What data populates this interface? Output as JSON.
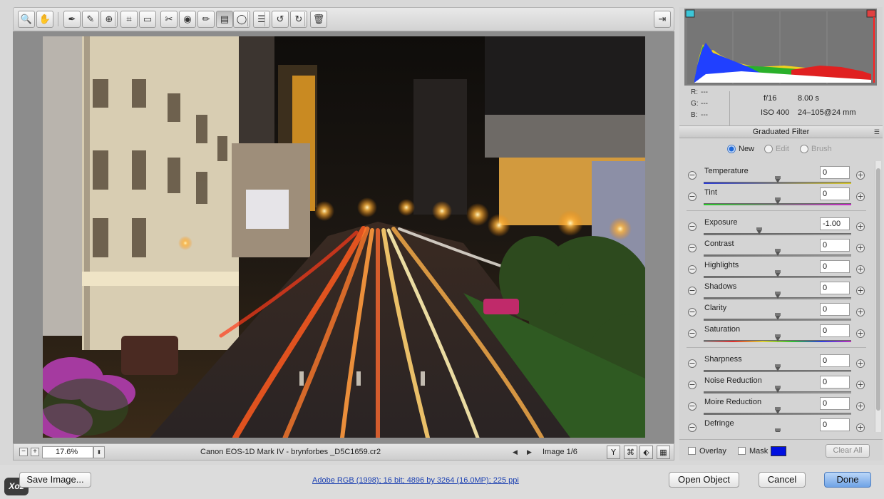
{
  "toolbar": {
    "tools": [
      {
        "name": "zoom-tool-icon",
        "glyph": "🔍"
      },
      {
        "name": "hand-tool-icon",
        "glyph": "✋"
      },
      {
        "name": "white-balance-tool-icon",
        "glyph": "✒"
      },
      {
        "name": "color-sampler-tool-icon",
        "glyph": "✎"
      },
      {
        "name": "targeted-adjustment-tool-icon",
        "glyph": "⊕"
      },
      {
        "name": "crop-tool-icon",
        "glyph": "⌗"
      },
      {
        "name": "straighten-tool-icon",
        "glyph": "▭"
      },
      {
        "name": "spot-removal-tool-icon",
        "glyph": "✂"
      },
      {
        "name": "red-eye-tool-icon",
        "glyph": "◉"
      },
      {
        "name": "adjustment-brush-icon",
        "glyph": "✏"
      },
      {
        "name": "graduated-filter-icon",
        "glyph": "▤"
      },
      {
        "name": "radial-filter-icon",
        "glyph": "◯"
      },
      {
        "name": "preferences-icon",
        "glyph": "☰"
      },
      {
        "name": "rotate-left-icon",
        "glyph": "↺"
      },
      {
        "name": "rotate-right-icon",
        "glyph": "↻"
      },
      {
        "name": "trash-icon",
        "glyph": "🗑"
      }
    ],
    "export_glyph": "⇥"
  },
  "status": {
    "zoom": "17.6%",
    "zoom_minus": "−",
    "zoom_plus": "+",
    "zoom_step": "⬍",
    "filename": "Canon EOS-1D Mark IV  -  brynforbes _D5C1659.cr2",
    "nav_prev": "◀",
    "nav_next": "▶",
    "image_count": "Image 1/6",
    "view_glyphs": [
      "Y",
      "⌘",
      "⬖",
      "▦"
    ]
  },
  "readout": {
    "r_label": "R:",
    "r_value": "---",
    "g_label": "G:",
    "g_value": "---",
    "b_label": "B:",
    "b_value": "---",
    "aperture": "f/16",
    "shutter": "8.00 s",
    "iso": "ISO 400",
    "lens": "24–105@24 mm"
  },
  "panel": {
    "title": "Graduated Filter",
    "menu_glyph": "☰",
    "modes": [
      {
        "label": "New",
        "selected": true
      },
      {
        "label": "Edit",
        "selected": false
      },
      {
        "label": "Brush",
        "selected": false
      }
    ],
    "sliders": [
      {
        "label": "Temperature",
        "value": "0",
        "level": 0.5,
        "track": "temp"
      },
      {
        "label": "Tint",
        "value": "0",
        "level": 0.5,
        "track": "tint"
      },
      {
        "label": "Exposure",
        "value": "-1.00",
        "level": 0.375,
        "track": "gray",
        "sep_before": true
      },
      {
        "label": "Contrast",
        "value": "0",
        "level": 0.5,
        "track": "gray"
      },
      {
        "label": "Highlights",
        "value": "0",
        "level": 0.5,
        "track": "gray"
      },
      {
        "label": "Shadows",
        "value": "0",
        "level": 0.5,
        "track": "gray"
      },
      {
        "label": "Clarity",
        "value": "0",
        "level": 0.5,
        "track": "gray"
      },
      {
        "label": "Saturation",
        "value": "0",
        "level": 0.5,
        "track": "sat"
      },
      {
        "label": "Sharpness",
        "value": "0",
        "level": 0.5,
        "track": "gray",
        "sep_before": true
      },
      {
        "label": "Noise Reduction",
        "value": "0",
        "level": 0.5,
        "track": "gray"
      },
      {
        "label": "Moire Reduction",
        "value": "0",
        "level": 0.5,
        "track": "gray"
      },
      {
        "label": "Defringe",
        "value": "0",
        "level": 0.5,
        "track": "gray"
      }
    ],
    "overlay_label": "Overlay",
    "mask_label": "Mask",
    "mask_color": "#0010e0",
    "clear_all": "Clear All"
  },
  "bottom": {
    "save_image": "Save Image...",
    "workflow_info": "Adobe RGB (1998); 16 bit; 4896 by 3264 (16.0MP); 225 ppi",
    "open_object": "Open Object",
    "cancel": "Cancel",
    "done": "Done",
    "logo": "Xoz"
  },
  "colors": {
    "accent": "#1f68d6",
    "primary_button": "#6fa3e6"
  }
}
